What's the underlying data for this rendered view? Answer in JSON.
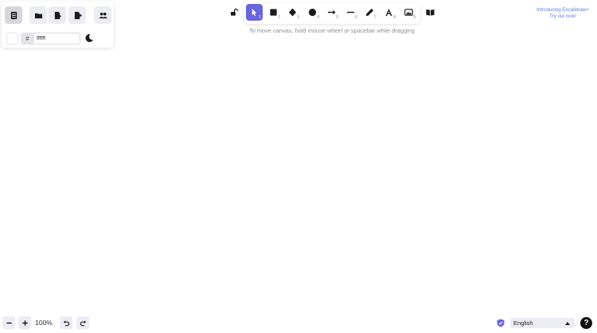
{
  "menu": {
    "color_hash": "#",
    "color_value": "ffffff",
    "icons": [
      "hamburger-menu-icon",
      "folder-open-icon",
      "save-icon",
      "export-icon",
      "collaboration-icon",
      "moon-icon"
    ]
  },
  "toolbar": {
    "tools": [
      {
        "name": "lock",
        "key": ""
      },
      {
        "name": "selection",
        "key": "1"
      },
      {
        "name": "rectangle",
        "key": "2"
      },
      {
        "name": "diamond",
        "key": "3"
      },
      {
        "name": "ellipse",
        "key": "4"
      },
      {
        "name": "arrow",
        "key": "5"
      },
      {
        "name": "line",
        "key": "6"
      },
      {
        "name": "draw",
        "key": "7"
      },
      {
        "name": "text",
        "key": "8"
      },
      {
        "name": "image",
        "key": "9"
      },
      {
        "name": "library",
        "key": ""
      }
    ],
    "active_tool": "selection",
    "active_color": "#6965db"
  },
  "hint": "To move canvas, hold mouse wheel or spacebar while dragging",
  "promo": {
    "line1": "Introducing Excalidraw+",
    "line2": "Try out now!"
  },
  "footer": {
    "zoom_out": "−",
    "zoom_in": "+",
    "zoom_level": "100%",
    "language": "English",
    "help": "?"
  }
}
